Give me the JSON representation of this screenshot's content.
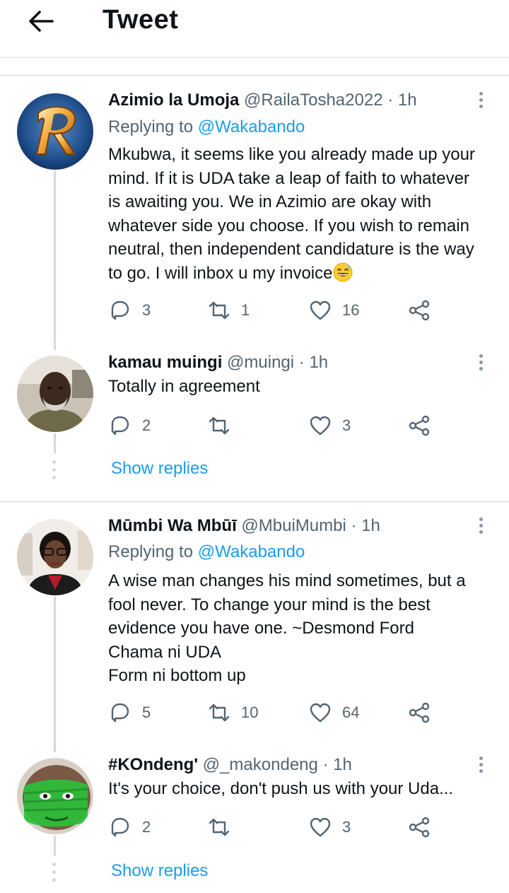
{
  "header": {
    "title": "Tweet",
    "back_icon": "arrow-left-icon"
  },
  "colors": {
    "accent": "#1d9bf0",
    "muted": "#536471",
    "text": "#0f1419",
    "divider": "#cfd3d7"
  },
  "threads": [
    {
      "tweet": {
        "name": "Azimio la Umoja",
        "handle": "@RailaTosha2022",
        "dot": "·",
        "time": "1h",
        "replying_label": "Replying to",
        "replying_to": "@Wakabando",
        "text_lines": [
          "Mkubwa, it seems like you already made up your",
          "mind. If it is UDA take a leap of faith to whatever",
          "is awaiting you. We in Azimio are okay with",
          "whatever side you choose. If you wish to remain",
          "neutral, then independent candidature is the way",
          "to go. I will inbox u my invoice"
        ],
        "emoji": "😅",
        "replies": "3",
        "retweets": "1",
        "likes": "16"
      },
      "reply": {
        "name": "kamau muingi",
        "handle": "@muingi",
        "dot": "·",
        "time": "1h",
        "text": "Totally in agreement",
        "replies": "2",
        "retweets": "",
        "likes": "3"
      },
      "show_replies": "Show replies"
    },
    {
      "tweet": {
        "name": "Mūmbi Wa Mbūī",
        "handle": "@MbuiMumbi",
        "dot": "·",
        "time": "1h",
        "replying_label": "Replying to",
        "replying_to": "@Wakabando",
        "text_lines": [
          "A wise man changes his mind sometimes, but a",
          "fool never. To change your mind is the best",
          "evidence you have one. ~Desmond Ford",
          "Chama ni UDA",
          "Form ni bottom up"
        ],
        "replies": "5",
        "retweets": "10",
        "likes": "64"
      },
      "reply": {
        "name": "#KOndeng'",
        "handle": "@_makondeng",
        "dot": "·",
        "time": "1h",
        "text": "It's your choice, don't push us with your Uda...",
        "replies": "2",
        "retweets": "",
        "likes": "3"
      },
      "show_replies": "Show replies"
    }
  ]
}
